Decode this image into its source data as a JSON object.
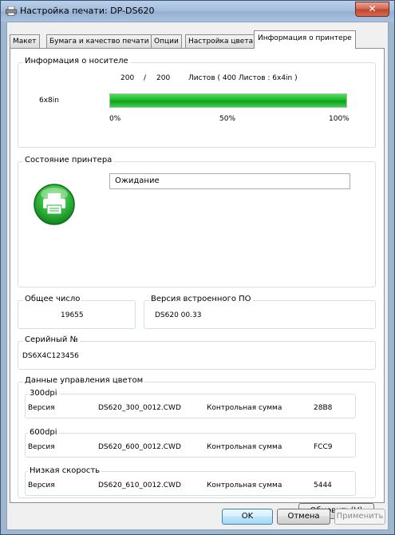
{
  "window": {
    "title": "Настройка печати: DP-DS620",
    "close_glyph": "✕"
  },
  "tabs": [
    {
      "label": "Макет"
    },
    {
      "label": "Бумага и качество печати"
    },
    {
      "label": "Опции"
    },
    {
      "label": "Настройка цвета"
    },
    {
      "label": "Информация о принтере"
    }
  ],
  "media": {
    "group_label": "Информация о носителе",
    "count_current": "200",
    "count_separator": "/",
    "count_total": "200",
    "sheets_text": "Листов ( 400 Листов : 6x4in )",
    "media_name": "6x8in",
    "progress_fraction": 1.0,
    "tick_0": "0%",
    "tick_50": "50%",
    "tick_100": "100%",
    "progress_color": "#16a923"
  },
  "printer_status": {
    "group_label": "Состояние принтера",
    "status_text": "Ожидание",
    "icon_color": "#2fb43b"
  },
  "totals": {
    "group_label": "Общее число",
    "value": "19655"
  },
  "firmware": {
    "group_label": "Версия встроенного ПО",
    "value": "DS620 00.33"
  },
  "serial": {
    "group_label": "Серийный №",
    "value": "DS6X4C123456"
  },
  "color_mgmt": {
    "group_label": "Данные управления цветом",
    "rows": [
      {
        "label": "300dpi",
        "version_label": "Версия",
        "file": "DS620_300_0012.CWD",
        "checksum_label": "Контрольная сумма",
        "checksum": "28B8"
      },
      {
        "label": "600dpi",
        "version_label": "Версия",
        "file": "DS620_600_0012.CWD",
        "checksum_label": "Контрольная сумма",
        "checksum": "FCC9"
      },
      {
        "label": "Низкая скорость",
        "version_label": "Версия",
        "file": "DS620_610_0012.CWD",
        "checksum_label": "Контрольная сумма",
        "checksum": "5444"
      }
    ]
  },
  "buttons": {
    "refresh": "Обновить(U)",
    "ok": "OK",
    "cancel": "Отмена",
    "apply": "Применить"
  }
}
